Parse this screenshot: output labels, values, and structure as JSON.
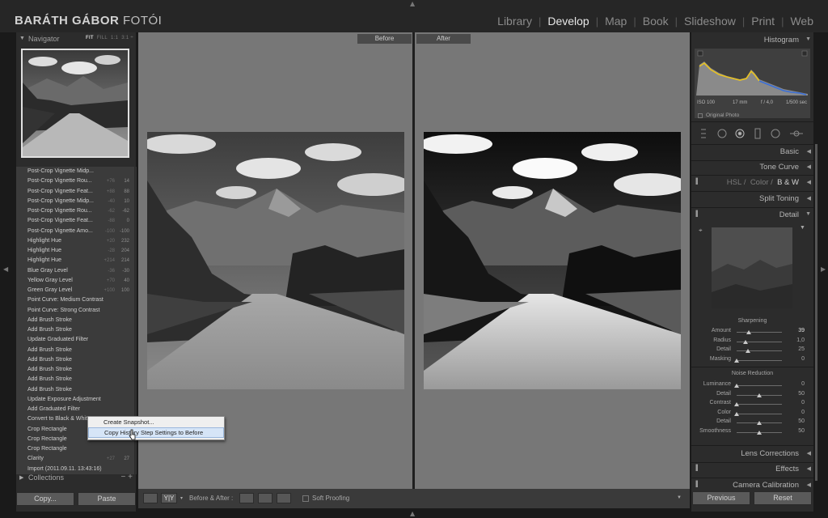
{
  "app": {
    "brand_main": "BARÁTH GÁBOR",
    "brand_thin": "FOTÓI",
    "modules": [
      "Library",
      "Develop",
      "Map",
      "Book",
      "Slideshow",
      "Print",
      "Web"
    ],
    "active_module": "Develop"
  },
  "navigator": {
    "title": "Navigator",
    "zoom_fit": "FIT",
    "zoom_fill": "FILL",
    "zoom_1": "1:1",
    "zoom_3": "3:1 ÷"
  },
  "history": [
    {
      "label": "Post-Crop Vignette Midp...",
      "v1": "",
      "v2": ""
    },
    {
      "label": "Post-Crop Vignette Rou...",
      "v1": "+76",
      "v2": "14"
    },
    {
      "label": "Post-Crop Vignette Feat...",
      "v1": "+88",
      "v2": "88"
    },
    {
      "label": "Post-Crop Vignette Midp...",
      "v1": "-40",
      "v2": "10"
    },
    {
      "label": "Post-Crop Vignette Rou...",
      "v1": "-62",
      "v2": "-62"
    },
    {
      "label": "Post-Crop Vignette Feat...",
      "v1": "-88",
      "v2": "0"
    },
    {
      "label": "Post-Crop Vignette Amo...",
      "v1": "-100",
      "v2": "-100"
    },
    {
      "label": "Highlight Hue",
      "v1": "+20",
      "v2": "232"
    },
    {
      "label": "Highlight Hue",
      "v1": "-28",
      "v2": "204"
    },
    {
      "label": "Highlight Hue",
      "v1": "+214",
      "v2": "214"
    },
    {
      "label": "Blue Gray Level",
      "v1": "-36",
      "v2": "-30"
    },
    {
      "label": "Yellow Gray Level",
      "v1": "+70",
      "v2": "40"
    },
    {
      "label": "Green Gray Level",
      "v1": "+100",
      "v2": "100"
    },
    {
      "label": "Point Curve: Medium Contrast",
      "v1": "",
      "v2": ""
    },
    {
      "label": "Point Curve: Strong Contrast",
      "v1": "",
      "v2": ""
    },
    {
      "label": "Add Brush Stroke",
      "v1": "",
      "v2": ""
    },
    {
      "label": "Add Brush Stroke",
      "v1": "",
      "v2": ""
    },
    {
      "label": "Update Graduated Filter",
      "v1": "",
      "v2": ""
    },
    {
      "label": "Add Brush Stroke",
      "v1": "",
      "v2": ""
    },
    {
      "label": "Add Brush Stroke",
      "v1": "",
      "v2": ""
    },
    {
      "label": "Add Brush Stroke",
      "v1": "",
      "v2": ""
    },
    {
      "label": "Add Brush Stroke",
      "v1": "",
      "v2": ""
    },
    {
      "label": "Add Brush Stroke",
      "v1": "",
      "v2": ""
    },
    {
      "label": "Update Exposure Adjustment",
      "v1": "",
      "v2": ""
    },
    {
      "label": "Add Graduated Filter",
      "v1": "",
      "v2": ""
    },
    {
      "label": "Convert to Black & White",
      "v1": "",
      "v2": ""
    },
    {
      "label": "Crop Rectangle",
      "v1": "",
      "v2": ""
    },
    {
      "label": "Crop Rectangle",
      "v1": "",
      "v2": ""
    },
    {
      "label": "Crop Rectangle",
      "v1": "",
      "v2": ""
    },
    {
      "label": "Clarity",
      "v1": "+27",
      "v2": "27"
    },
    {
      "label": "Import (2011.09.11. 13:43:16)",
      "v1": "",
      "v2": ""
    }
  ],
  "collections": {
    "label": "Collections",
    "controls": "−  +"
  },
  "left_buttons": {
    "copy": "Copy...",
    "paste": "Paste"
  },
  "context_menu": {
    "items": [
      "Create Snapshot...",
      "Copy History Step Settings to Before"
    ]
  },
  "center": {
    "before_label": "Before",
    "after_label": "After"
  },
  "toolbar": {
    "view_mode": "Y|Y",
    "before_after_label": "Before & After :",
    "soft_proofing": "Soft Proofing"
  },
  "right": {
    "histogram_title": "Histogram",
    "iso": "ISO 100",
    "focal": "17 mm",
    "aperture": "f / 4,0",
    "shutter": "1/500 sec",
    "original_photo": "Original Photo",
    "panels": {
      "basic": "Basic",
      "tone_curve": "Tone Curve",
      "hsl": "HSL",
      "color": "Color",
      "bw": "B & W",
      "split_toning": "Split Toning",
      "detail": "Detail",
      "lens": "Lens Corrections",
      "effects": "Effects",
      "calibration": "Camera Calibration"
    },
    "sharpening": {
      "title": "Sharpening",
      "rows": [
        {
          "label": "Amount",
          "value": "39",
          "level": 0.26
        },
        {
          "label": "Radius",
          "value": "1,0",
          "level": 0.2
        },
        {
          "label": "Detail",
          "value": "25",
          "level": 0.25
        },
        {
          "label": "Masking",
          "value": "0",
          "level": 0.0
        }
      ]
    },
    "noise": {
      "title": "Noise Reduction",
      "rows": [
        {
          "label": "Luminance",
          "value": "0",
          "level": 0.0
        },
        {
          "label": "Detail",
          "value": "50",
          "level": 0.5
        },
        {
          "label": "Contrast",
          "value": "0",
          "level": 0.0
        },
        {
          "label": "Color",
          "value": "0",
          "level": 0.0
        },
        {
          "label": "Detail",
          "value": "50",
          "level": 0.5
        },
        {
          "label": "Smoothness",
          "value": "50",
          "level": 0.5
        }
      ]
    },
    "buttons": {
      "previous": "Previous",
      "reset": "Reset"
    }
  },
  "colors": {
    "accent_active": "#e8e8e8",
    "menu_highlight": "#d6e5f7",
    "histogram_blue": "#3a6fd8",
    "histogram_yellow": "#e8c220"
  }
}
